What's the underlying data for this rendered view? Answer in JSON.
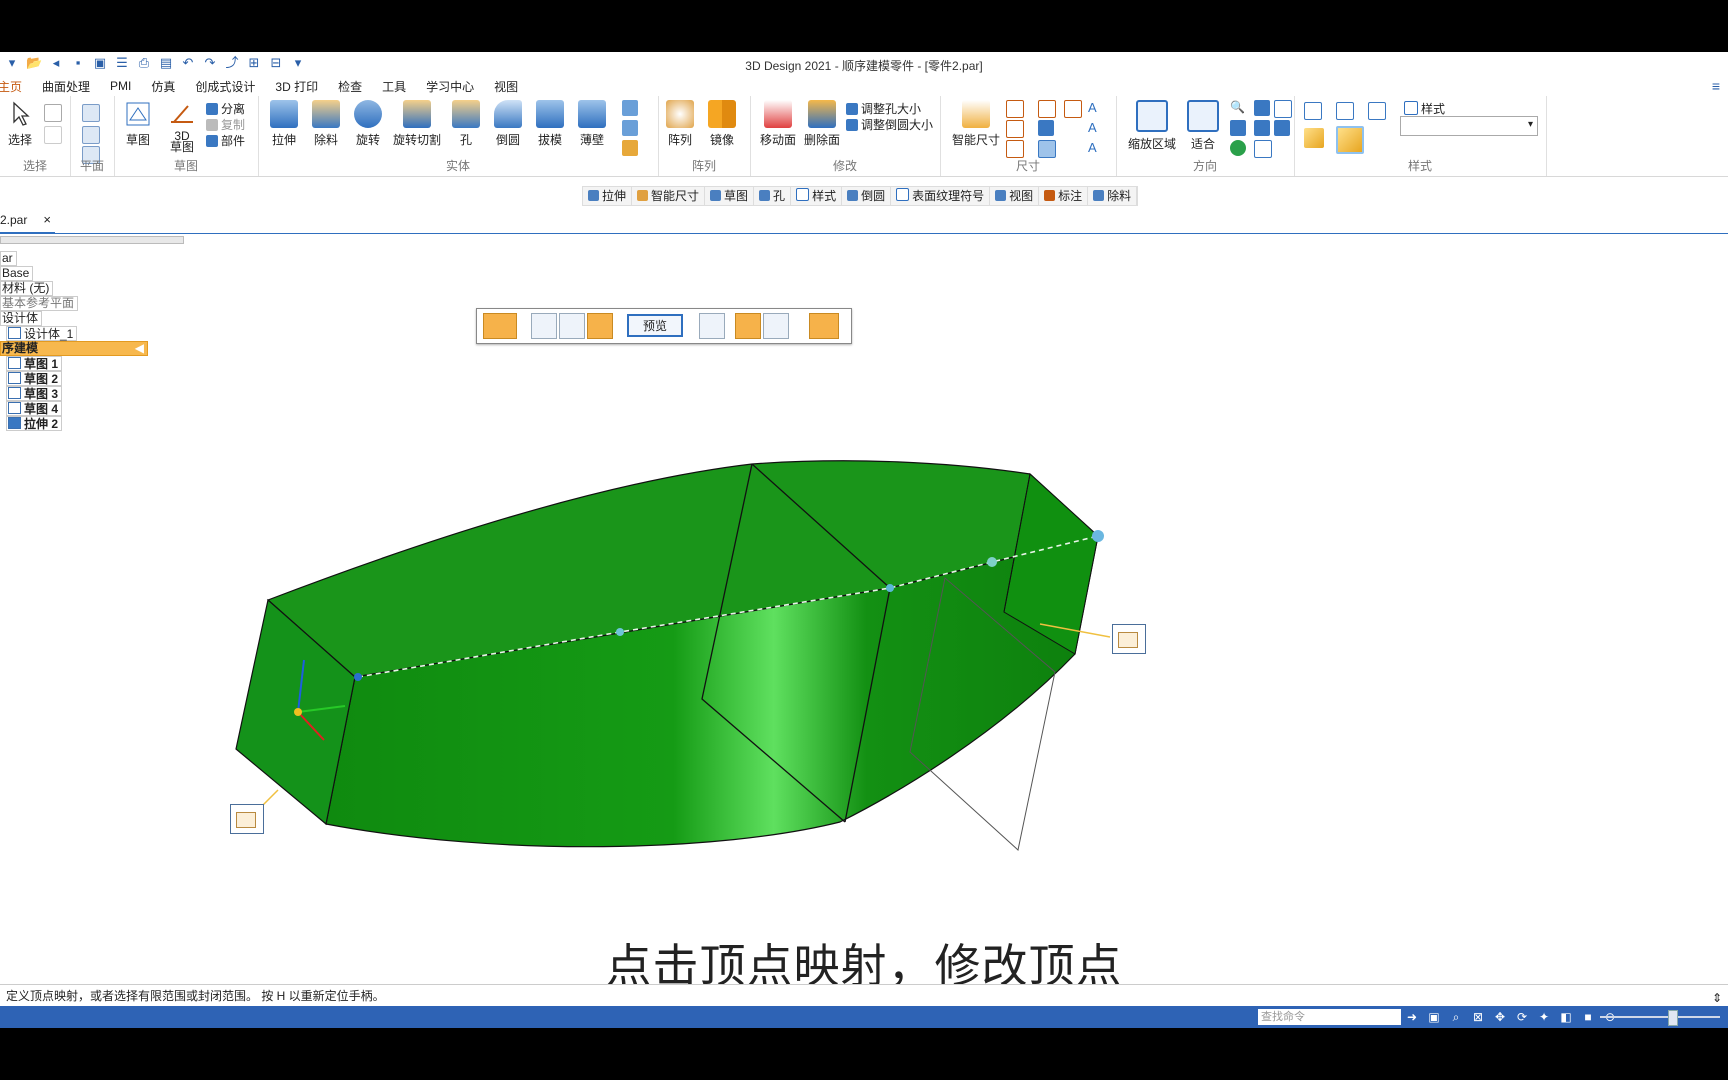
{
  "window": {
    "title": "3D Design 2021 - 顺序建模零件 - [零件2.par]"
  },
  "quick_access": [
    "menu-icon",
    "open-icon",
    "undo-history-icon",
    "save-icon",
    "save-all-icon",
    "properties-icon",
    "print-icon",
    "folder-icon",
    "undo-icon",
    "redo-icon",
    "link-icon",
    "new-window-icon",
    "close-window-icon",
    "customize-icon"
  ],
  "menu_tabs": [
    "主页",
    "曲面处理",
    "PMI",
    "仿真",
    "创成式设计",
    "3D 打印",
    "检查",
    "工具",
    "学习中心",
    "视图"
  ],
  "ribbon": {
    "select": {
      "label": "选择",
      "group": "选择"
    },
    "plane": {
      "group": "平面"
    },
    "sketch": {
      "sketch_label": "草图",
      "sketch3d_label": "3D\n草图",
      "separate_label": "分离",
      "copy_label": "复制",
      "part_label": "部件",
      "group": "草图"
    },
    "solids": {
      "items": [
        "拉伸",
        "除料",
        "旋转",
        "旋转切割",
        "孔",
        "倒圆",
        "拔模",
        "薄壁"
      ],
      "group": "实体"
    },
    "pattern": {
      "items": [
        "阵列",
        "镜像"
      ],
      "group": "阵列"
    },
    "modify": {
      "move_face": "移动面",
      "delete_face": "删除面",
      "resize_hole": "调整孔大小",
      "resize_round": "调整倒圆大小",
      "group": "修改"
    },
    "dimension": {
      "smart_dim": "智能尺寸",
      "group": "尺寸"
    },
    "orient": {
      "zoom_area": "缩放区域",
      "fit": "适合",
      "group": "方向"
    },
    "style": {
      "label": "样式",
      "group": "样式"
    }
  },
  "command_bar": [
    "拉伸",
    "智能尺寸",
    "草图",
    "孔",
    "样式",
    "倒圆",
    "表面纹理符号",
    "视图",
    "标注",
    "除料"
  ],
  "document_tab": {
    "name": "2.par",
    "close": "×"
  },
  "pathfinder": {
    "items": [
      {
        "label": "ar",
        "style": "normal"
      },
      {
        "label": "Base",
        "style": "normal"
      },
      {
        "label": "材料 (无)",
        "style": "normal"
      },
      {
        "label": "基本参考平面",
        "style": "gray"
      },
      {
        "label": "设计体",
        "style": "normal"
      },
      {
        "label": "设计体_1",
        "style": "normal"
      },
      {
        "label": "序建模",
        "style": "selected"
      },
      {
        "label": "草图 1",
        "style": "bold"
      },
      {
        "label": "草图 2",
        "style": "bold"
      },
      {
        "label": "草图 3",
        "style": "bold"
      },
      {
        "label": "草图 4",
        "style": "bold"
      },
      {
        "label": "拉伸 2",
        "style": "bold"
      }
    ]
  },
  "quickbar": {
    "preview_label": "预览"
  },
  "subtitle": "点击顶点映射，修改顶点",
  "status": {
    "prompt": "定义顶点映射，或者选择有限范围或封闭范围。 按 H 以重新定位手柄。"
  },
  "bottom": {
    "search_placeholder": "查找命令"
  },
  "colors": {
    "model_green": "#1f9a1f",
    "accent_orange": "#f6b24a",
    "status_blue": "#2e63b5"
  }
}
